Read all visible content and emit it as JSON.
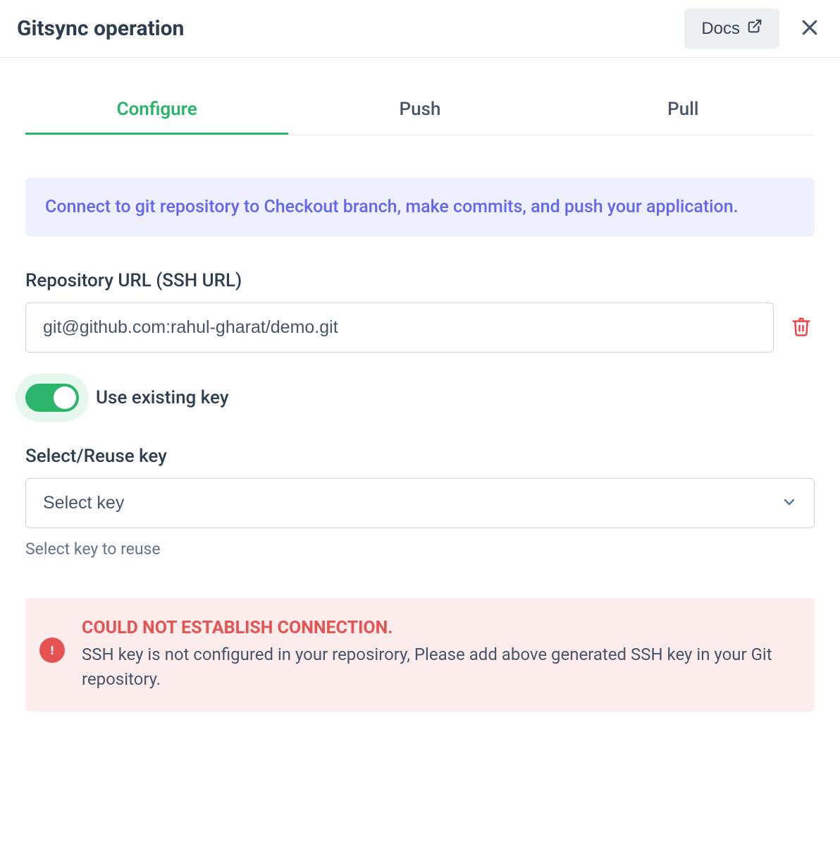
{
  "header": {
    "title": "Gitsync operation",
    "docs_label": "Docs"
  },
  "tabs": [
    {
      "label": "Configure",
      "active": true
    },
    {
      "label": "Push",
      "active": false
    },
    {
      "label": "Pull",
      "active": false
    }
  ],
  "info_banner": "Connect to git repository to Checkout branch, make commits, and push your application.",
  "repo": {
    "label": "Repository URL (SSH URL)",
    "value": "git@github.com:rahul-gharat/demo.git"
  },
  "toggle": {
    "label": "Use existing key",
    "checked": true
  },
  "select_key": {
    "label": "Select/Reuse key",
    "placeholder": "Select key",
    "helper": "Select key to reuse"
  },
  "error": {
    "title": "COULD NOT ESTABLISH CONNECTION.",
    "message": "SSH key is not configured in your reposirory, Please add above generated SSH key in your Git repository."
  }
}
